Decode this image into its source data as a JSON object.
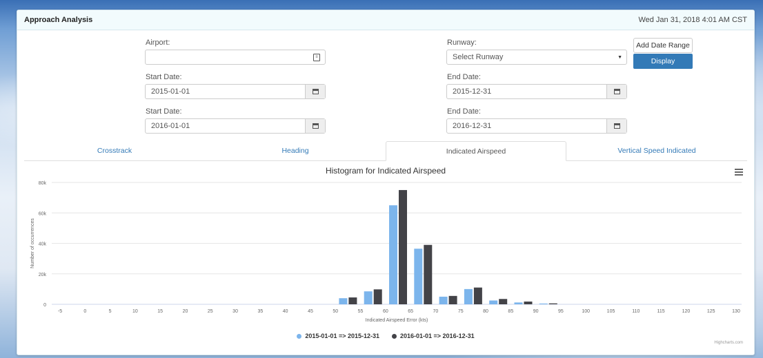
{
  "header": {
    "title": "Approach Analysis",
    "datetime": "Wed Jan 31, 2018 4:01 AM CST"
  },
  "form": {
    "airport_label": "Airport:",
    "airport_value": "",
    "runway_label": "Runway:",
    "runway_selected": "Select Runway",
    "ranges": [
      {
        "start_label": "Start Date:",
        "start_value": "2015-01-01",
        "end_label": "End Date:",
        "end_value": "2015-12-31"
      },
      {
        "start_label": "Start Date:",
        "start_value": "2016-01-01",
        "end_label": "End Date:",
        "end_value": "2016-12-31"
      }
    ],
    "add_range_label": "Add Date Range",
    "display_label": "Display"
  },
  "tabs": [
    {
      "label": "Crosstrack",
      "active": false
    },
    {
      "label": "Heading",
      "active": false
    },
    {
      "label": "Indicated Airspeed",
      "active": true
    },
    {
      "label": "Vertical Speed Indicated",
      "active": false
    }
  ],
  "chart_data": {
    "type": "bar",
    "title": "Histogram for Indicated Airspeed",
    "xlabel": "Indicated Airspeed Error (kts)",
    "ylabel": "Number of occurrences",
    "ylim": [
      0,
      80000
    ],
    "yticks": [
      "0",
      "20k",
      "40k",
      "60k",
      "80k"
    ],
    "categories": [
      "-5",
      "0",
      "5",
      "10",
      "15",
      "20",
      "25",
      "30",
      "35",
      "40",
      "45",
      "50",
      "55",
      "60",
      "65",
      "70",
      "75",
      "80",
      "85",
      "90",
      "95",
      "100",
      "105",
      "110",
      "115",
      "120",
      "125",
      "130"
    ],
    "series": [
      {
        "name": "2015-01-01 => 2015-12-31",
        "color": "#7cb5ec",
        "values": [
          0,
          0,
          0,
          0,
          0,
          0,
          0,
          0,
          0,
          0,
          0,
          4000,
          8500,
          65000,
          36500,
          5000,
          10000,
          2500,
          1200,
          500,
          0,
          0,
          0,
          0,
          0,
          0,
          0,
          0
        ]
      },
      {
        "name": "2016-01-01 => 2016-12-31",
        "color": "#434348",
        "values": [
          0,
          0,
          0,
          0,
          0,
          0,
          0,
          0,
          0,
          0,
          0,
          4500,
          9800,
          75000,
          39000,
          5500,
          11000,
          3500,
          1800,
          600,
          0,
          0,
          0,
          0,
          0,
          0,
          0,
          0
        ]
      }
    ],
    "grid": true,
    "legend_position": "bottom-center",
    "credits": "Highcharts.com"
  },
  "icons": {
    "menu": "hamburger-menu-icon",
    "calendar": "calendar-icon"
  }
}
